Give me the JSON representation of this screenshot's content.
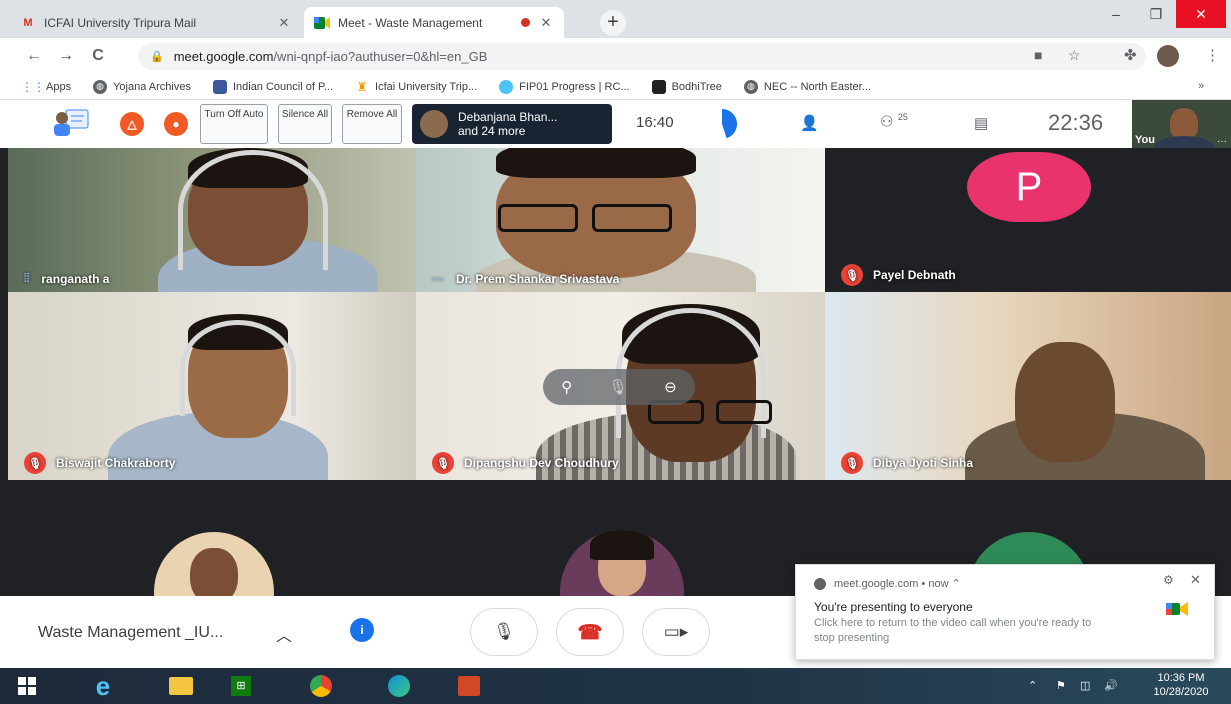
{
  "browser": {
    "tabs": [
      {
        "title": "ICFAI University Tripura Mail",
        "close": "✕"
      },
      {
        "title": "Meet - Waste Management",
        "close": "✕"
      }
    ],
    "new_tab": "+",
    "window": {
      "min": "–",
      "max": "❐",
      "close": "✕"
    },
    "nav": {
      "back": "←",
      "forward": "→",
      "reload": "C"
    },
    "url": {
      "host": "meet.google.com",
      "path": "/wni-qnpf-iao?authuser=0&hl=en_GB"
    },
    "bookmarks": [
      {
        "label": "Apps",
        "color": "#4285f4"
      },
      {
        "label": "Yojana Archives",
        "color": "#5f6368"
      },
      {
        "label": "Indian Council of P...",
        "color": "#3b5998"
      },
      {
        "label": "Icfai University Trip...",
        "color": "#f29900"
      },
      {
        "label": "FIP01 Progress | RC...",
        "color": "#4fc3f7"
      },
      {
        "label": "BodhiTree",
        "color": "#202124"
      },
      {
        "label": "NEC -- North Easter...",
        "color": "#5f6368"
      }
    ],
    "bookmarks_more": "»"
  },
  "meet_top": {
    "turn_off_auto": "Turn Off Auto",
    "silence_all": "Silence All",
    "remove_all": "Remove All",
    "presenter_line1": "Debanjana Bhan...",
    "presenter_line2": "and 24 more",
    "elapsed": "16:40",
    "participants_count": "25",
    "clock": "22:36",
    "self_label": "You",
    "timer_fraction": 0.45
  },
  "participants": [
    {
      "name": "ranganath a",
      "muted": false
    },
    {
      "name": "Dr. Prem Shankar Srivastava",
      "muted": false
    },
    {
      "name": "Payel Debnath",
      "muted": true,
      "initial": "P",
      "avatar_color": "#e8336d"
    },
    {
      "name": "Biswajit Chakraborty",
      "muted": true
    },
    {
      "name": "Dipangshu Dev Choudhury",
      "muted": true
    },
    {
      "name": "Dibya Jyoti Sinha",
      "muted": true
    }
  ],
  "meet_bottom": {
    "meeting_name": "Waste Management _IU...",
    "info_icon": "i"
  },
  "notification": {
    "source": "meet.google.com • now ⌃",
    "title": "You're presenting to everyone",
    "body": "Click here to return to the video call when you're ready to stop presenting"
  },
  "taskbar": {
    "time": "10:36 PM",
    "date": "10/28/2020"
  }
}
